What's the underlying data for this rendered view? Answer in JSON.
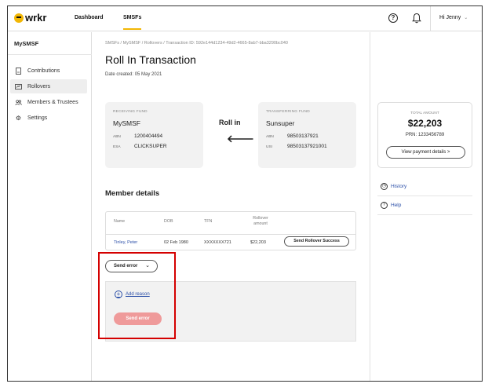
{
  "brand": {
    "logo_text": "wrkr"
  },
  "topnav": {
    "links": [
      "Dashboard",
      "SMSFs"
    ],
    "active_link": "SMSFs",
    "user_label": "Hi Jenny"
  },
  "sidebar": {
    "title": "MySMSF",
    "items": [
      {
        "label": "Contributions",
        "icon": "document-icon"
      },
      {
        "label": "Rollovers",
        "icon": "rollover-icon"
      },
      {
        "label": "Members & Trustees",
        "icon": "people-icon"
      },
      {
        "label": "Settings",
        "icon": "gear-icon"
      }
    ],
    "active_item": "Rollovers"
  },
  "breadcrumb": "SMSFs / MySMSF / Rollovers / Transaction ID: 592e144d1234-49d2-4665-8ab7-bba3290bc040",
  "page": {
    "title": "Roll In Transaction",
    "date_created": "Date created: 05 May 2021"
  },
  "receiving_fund": {
    "label": "RECEIVING FUND",
    "name": "MySMSF",
    "abn_key": "ABN",
    "abn": "1200404494",
    "esa_key": "ESA",
    "esa": "CLICKSUPER"
  },
  "roll_in_label": "Roll in",
  "transferring_fund": {
    "label": "TRANSFERRING FUND",
    "name": "Sunsuper",
    "abn_key": "ABN",
    "abn": "98503137921",
    "usi_key": "USI",
    "usi": "98503137921001"
  },
  "total": {
    "label": "TOTAL AMOUNT",
    "amount": "$22,203",
    "prn": "PRN: 1233456789",
    "button": "View payment details >"
  },
  "side_links": [
    {
      "label": "History",
      "icon": "clock-icon"
    },
    {
      "label": "Help",
      "icon": "question-icon"
    }
  ],
  "member_details": {
    "title": "Member details",
    "headers": [
      "Name",
      "DOB",
      "TFN",
      "Rollover\namount"
    ],
    "row": {
      "name": "Tinley, Peter",
      "dob": "02 Feb 1980",
      "tfn": "XXXXXXX721",
      "amount": "$22,203",
      "action": "Send Rollover Success"
    }
  },
  "error_section": {
    "dropdown": "Send error",
    "add_reason": "Add reason",
    "send_button": "Send error"
  },
  "colors": {
    "accent": "#f2b705",
    "link": "#2b4fa8",
    "highlight": "#d40000",
    "disabled_error": "#ef9a9a"
  }
}
